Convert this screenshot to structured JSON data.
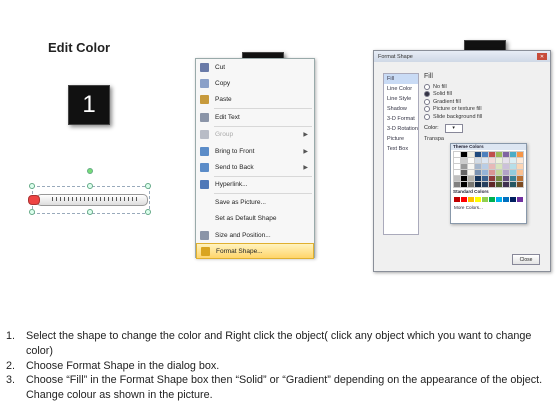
{
  "title": "Edit Color",
  "steps": [
    "1",
    "2",
    "3"
  ],
  "context_menu": {
    "items": [
      {
        "label": "Cut",
        "icon": "scissors-icon",
        "color": "#6a7ba8"
      },
      {
        "label": "Copy",
        "icon": "copy-icon",
        "color": "#8aa0c8"
      },
      {
        "label": "Paste",
        "icon": "paste-icon",
        "color": "#c79a3c"
      },
      {
        "label": "Edit Text",
        "icon": "edit-text-icon",
        "color": "#8b95a8"
      },
      {
        "label": "Group",
        "icon": "group-icon",
        "color": "#b8bcc6",
        "submenu": true,
        "disabled": true
      },
      {
        "label": "Bring to Front",
        "icon": "bring-front-icon",
        "color": "#5b8cc8",
        "submenu": true
      },
      {
        "label": "Send to Back",
        "icon": "send-back-icon",
        "color": "#5b8cc8",
        "submenu": true
      },
      {
        "label": "Hyperlink...",
        "icon": "hyperlink-icon",
        "color": "#4f78b8"
      },
      {
        "label": "Save as Picture...",
        "icon": "",
        "color": ""
      },
      {
        "label": "Set as Default Shape",
        "icon": "",
        "color": ""
      },
      {
        "label": "Size and Position...",
        "icon": "size-position-icon",
        "color": "#8b95a8"
      },
      {
        "label": "Format Shape...",
        "icon": "format-shape-icon",
        "color": "#d9a520",
        "highlighted": true
      }
    ]
  },
  "dialog": {
    "title": "Format Shape",
    "nav": [
      "Fill",
      "Line Color",
      "Line Style",
      "Shadow",
      "3-D Format",
      "3-D Rotation",
      "Picture",
      "Text Box"
    ],
    "heading": "Fill",
    "options": [
      {
        "label": "No fill",
        "selected": false
      },
      {
        "label": "Solid fill",
        "selected": true
      },
      {
        "label": "Gradient fill",
        "selected": false
      },
      {
        "label": "Picture or texture fill",
        "selected": false
      },
      {
        "label": "Slide background fill",
        "selected": false
      }
    ],
    "color_label": "Color:",
    "transparency_label": "Transpa",
    "close_label": "Close"
  },
  "palette": {
    "theme_header": "Theme Colors",
    "standard_header": "Standard Colors",
    "more_colors": "More Colors...",
    "theme_top": [
      "#ffffff",
      "#000000",
      "#eeece1",
      "#1f497d",
      "#4f81bd",
      "#c0504d",
      "#9bbb59",
      "#8064a2",
      "#4bacc6",
      "#f79646"
    ],
    "standard": [
      "#c00000",
      "#ff0000",
      "#ffc000",
      "#ffff00",
      "#92d050",
      "#00b050",
      "#00b0f0",
      "#0070c0",
      "#002060",
      "#7030a0"
    ]
  },
  "instructions": [
    "Select the shape to change the color and Right click the object( click any object which you want to change color)",
    "Choose Format Shape in the dialog box.",
    "Choose “Fill” in the Format Shape box then “Solid” or “Gradient” depending on the appearance of the object. Change colour as shown in the picture."
  ]
}
